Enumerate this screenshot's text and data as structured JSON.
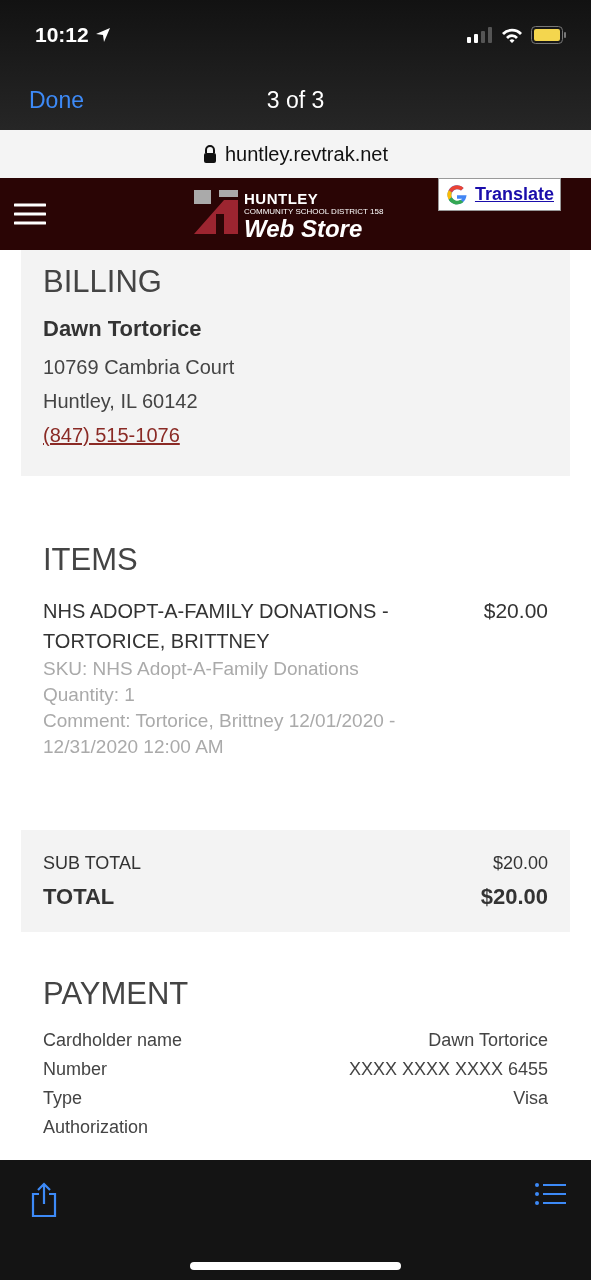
{
  "status_bar": {
    "time": "10:12"
  },
  "viewer": {
    "done": "Done",
    "title": "3 of 3"
  },
  "url_bar": {
    "url": "huntley.revtrak.net"
  },
  "site_header": {
    "logo_name": "HUNTLEY",
    "logo_sub": "COMMUNITY SCHOOL DISTRICT 158",
    "logo_store": "Web Store",
    "translate": "Translate"
  },
  "billing": {
    "heading": "BILLING",
    "name": "Dawn Tortorice",
    "lines": [
      "10769 Cambria Court",
      "Huntley, IL 60142"
    ],
    "phone": "(847) 515-1076"
  },
  "items": {
    "heading": "ITEMS",
    "list": [
      {
        "title": "NHS ADOPT-A-FAMILY DONATIONS - TORTORICE, BRITTNEY",
        "price": "$20.00",
        "details": [
          "SKU: NHS Adopt-A-Family Donations",
          "Quantity: 1",
          "Comment: Tortorice, Brittney 12/01/2020 - 12/31/2020 12:00 AM"
        ]
      }
    ]
  },
  "totals": [
    {
      "label": "SUB TOTAL",
      "value": "$20.00",
      "kind": "sub"
    },
    {
      "label": "TOTAL",
      "value": "$20.00",
      "kind": "grand"
    }
  ],
  "payment": {
    "heading": "PAYMENT",
    "rows": [
      {
        "label": "Cardholder name",
        "value": "Dawn Tortorice"
      },
      {
        "label": "Number",
        "value": "XXXX XXXX XXXX 6455"
      },
      {
        "label": "Type",
        "value": "Visa"
      },
      {
        "label": "Authorization"
      }
    ]
  }
}
